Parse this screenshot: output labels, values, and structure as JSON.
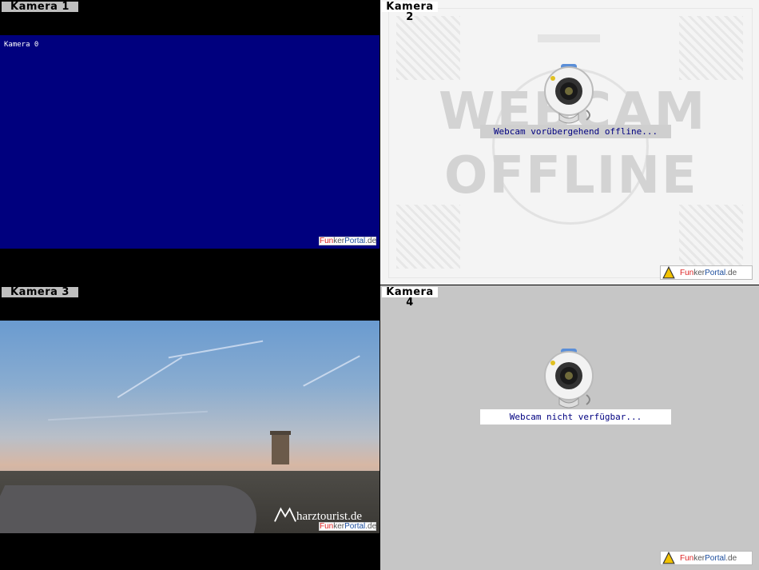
{
  "cameras": [
    {
      "label": "Kamera 1",
      "osd_text": "Kamera 0",
      "watermark": {
        "a": "Fun",
        "b": "ker",
        "c": "Portal",
        "d": ".de"
      }
    },
    {
      "label": "Kamera 2",
      "background_text": [
        "WEBCAM",
        "OFFLINE"
      ],
      "status": "Webcam vorübergehend offline...",
      "watermark": {
        "a": "Fun",
        "b": "ker",
        "c": "Portal",
        "d": ".de"
      }
    },
    {
      "label": "Kamera 3",
      "overlay": "harztourist.de",
      "watermark": {
        "a": "Fun",
        "b": "ker",
        "c": "Portal",
        "d": ".de"
      }
    },
    {
      "label": "Kamera 4",
      "status": "Webcam nicht verfügbar...",
      "watermark": {
        "a": "Fun",
        "b": "ker",
        "c": "Portal",
        "d": ".de"
      }
    }
  ],
  "icons": [
    "webcam-icon",
    "funkerportal-logo-icon",
    "harztourist-logo-icon"
  ],
  "colors": {
    "osd_blue": "#00007e",
    "status_text": "#000080",
    "label_bg": "#bfbfbf"
  }
}
